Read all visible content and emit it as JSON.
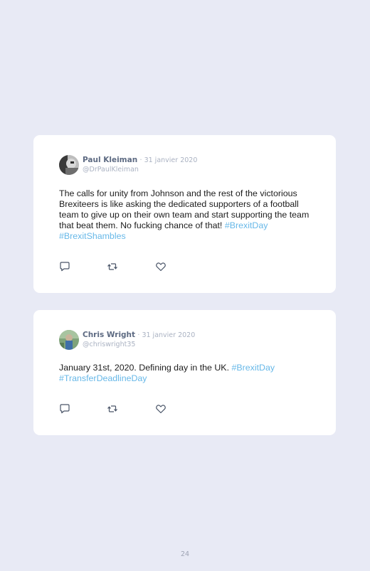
{
  "colors": {
    "page_background": "#e8eaf5",
    "card_background": "#ffffff",
    "name": "#5d6a82",
    "muted": "#aab2c2",
    "hashtag": "#67b8e8",
    "body_text": "#1c1c1c"
  },
  "tweets": [
    {
      "name": "Paul Kleiman",
      "date": "· 31 janvier 2020",
      "handle": "@DrPaulKleiman",
      "text": "The calls for unity from Johnson and the rest of the victorious Brexiteers is like asking the dedicated supporters of a football team to give up on their own team and start supporting the team that beat them. No fucking chance of that!",
      "hashtags": [
        "#BrexitDay",
        "#BrexitShambles"
      ],
      "icons": [
        "reply-icon",
        "retweet-icon",
        "like-icon"
      ]
    },
    {
      "name": "Chris Wright",
      "date": "· 31 janvier 2020",
      "handle": "@chriswright35",
      "text": "January 31st, 2020. Defining day in the UK.",
      "hashtags": [
        "#BrexitDay",
        "#TransferDeadlineDay"
      ],
      "icons": [
        "reply-icon",
        "retweet-icon",
        "like-icon"
      ]
    }
  ],
  "page_number": "24"
}
